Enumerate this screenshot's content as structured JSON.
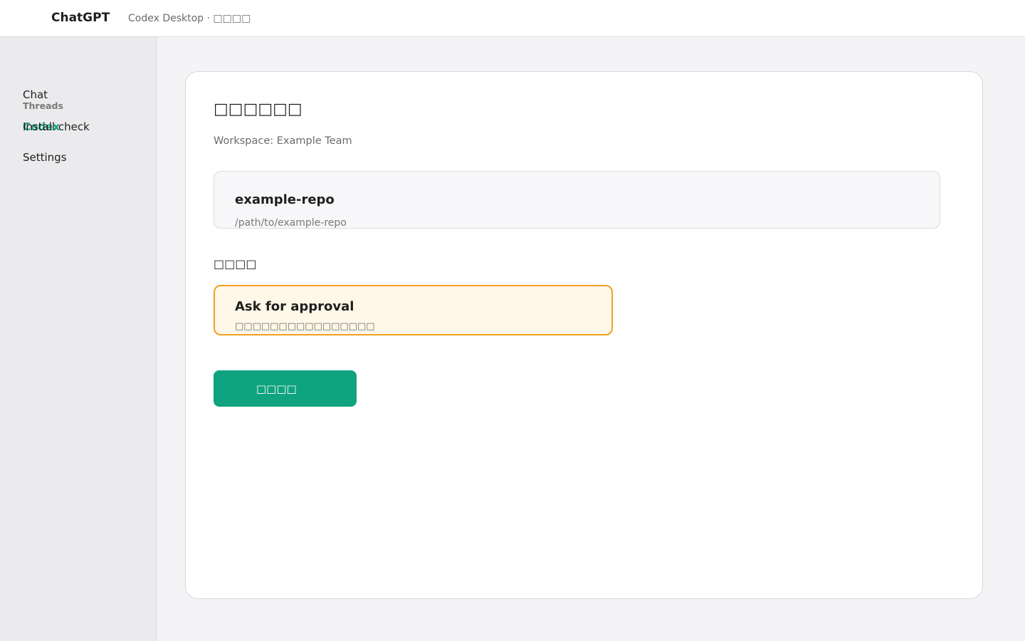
{
  "header": {
    "brand": "ChatGPT",
    "subtitle": "Codex Desktop · □□□□"
  },
  "sidebar": {
    "items": [
      {
        "label": "Chat"
      },
      {
        "label": "Threads"
      },
      {
        "label": "Codex"
      },
      {
        "label": "Install check"
      },
      {
        "label": "Settings"
      }
    ]
  },
  "main": {
    "title": "□□□□□□",
    "workspace": "Workspace: Example Team",
    "repo": {
      "name": "example-repo",
      "path": "/path/to/example-repo"
    },
    "section_label": "□□□□",
    "approval": {
      "title": "Ask for approval",
      "description": "□□□□□□□□□□□□□□□□"
    },
    "primary_button": "□□□□"
  },
  "colors": {
    "accent": "#10a37f",
    "approval_border": "#f0a020",
    "approval_bg": "#fff7e8"
  }
}
